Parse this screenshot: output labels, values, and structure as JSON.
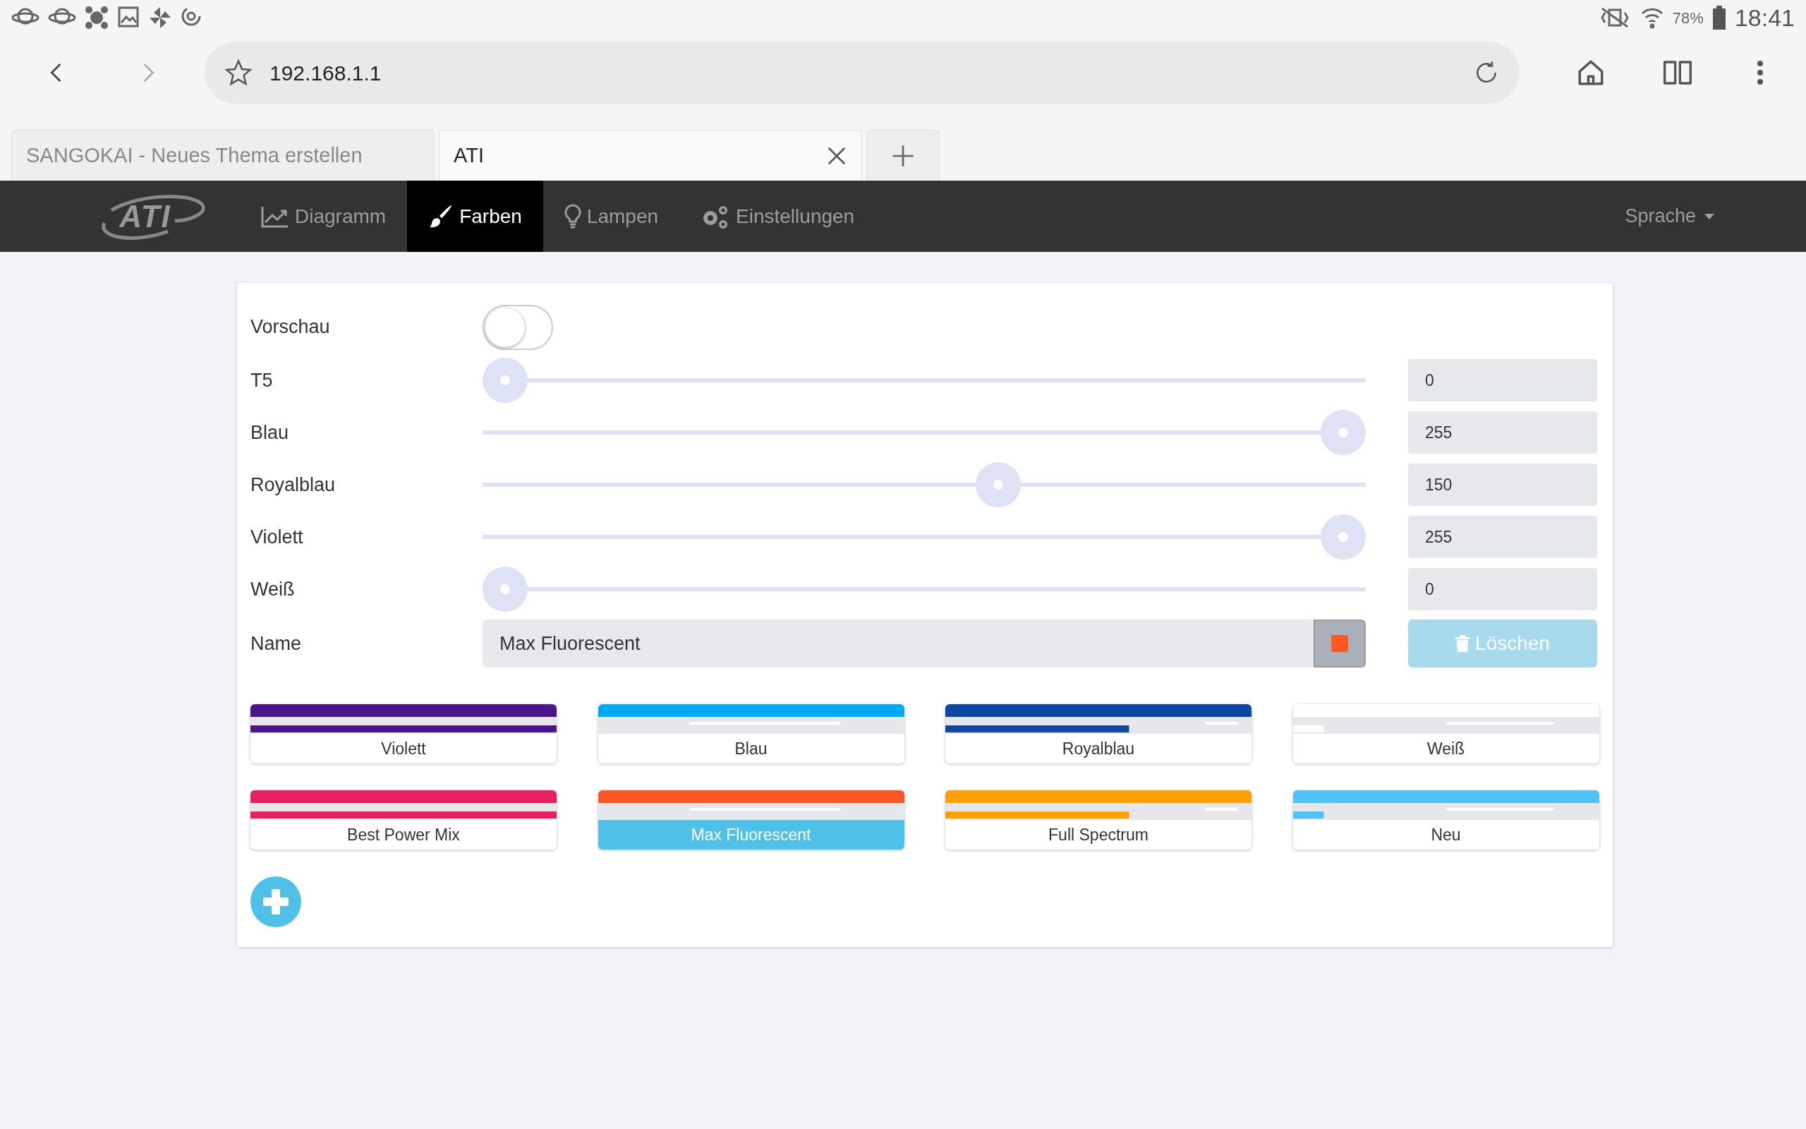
{
  "status_bar": {
    "battery": "78%",
    "time": "18:41"
  },
  "browser": {
    "url": "192.168.1.1",
    "tabs": [
      {
        "title": "SANGOKAI - Neues Thema erstellen",
        "selected": false
      },
      {
        "title": "ATI",
        "selected": true
      }
    ]
  },
  "nav": {
    "logo": "ATI",
    "items": [
      {
        "label": "Diagramm",
        "selected": false
      },
      {
        "label": "Farben",
        "selected": true
      },
      {
        "label": "Lampen",
        "selected": false
      },
      {
        "label": "Einstellungen",
        "selected": false
      }
    ],
    "language": "Sprache"
  },
  "form": {
    "preview": {
      "label": "Vorschau",
      "on": false
    },
    "channels": [
      {
        "name": "T5",
        "level": 0,
        "value": "0"
      },
      {
        "name": "Blau",
        "level": 1,
        "value": "255"
      },
      {
        "name": "Royalblau",
        "level": 0.588,
        "value": "150"
      },
      {
        "name": "Violett",
        "level": 1,
        "value": "255"
      },
      {
        "name": "Weiß",
        "level": 0,
        "value": "0"
      }
    ],
    "name": {
      "label": "Name",
      "value": "Max Fluorescent",
      "color": "#ff5722"
    },
    "delete_button": {
      "label": "Löschen",
      "disabled": true
    }
  },
  "presets": [
    {
      "label": "Violett",
      "color": "#4a148c",
      "selected": false
    },
    {
      "label": "Blau",
      "color": "#03a9f4",
      "selected": false
    },
    {
      "label": "Royalblau",
      "color": "#0d47a1",
      "selected": false
    },
    {
      "label": "Weiß",
      "color": "#ffffff",
      "selected": false
    },
    {
      "label": "Best Power Mix",
      "color": "#e91e63",
      "selected": false
    },
    {
      "label": "Max Fluorescent",
      "color": "#ff5722",
      "selected": true
    },
    {
      "label": "Full Spectrum",
      "color": "#ffa000",
      "selected": false
    },
    {
      "label": "Neu",
      "color": "#4fc3f7",
      "selected": false
    }
  ]
}
